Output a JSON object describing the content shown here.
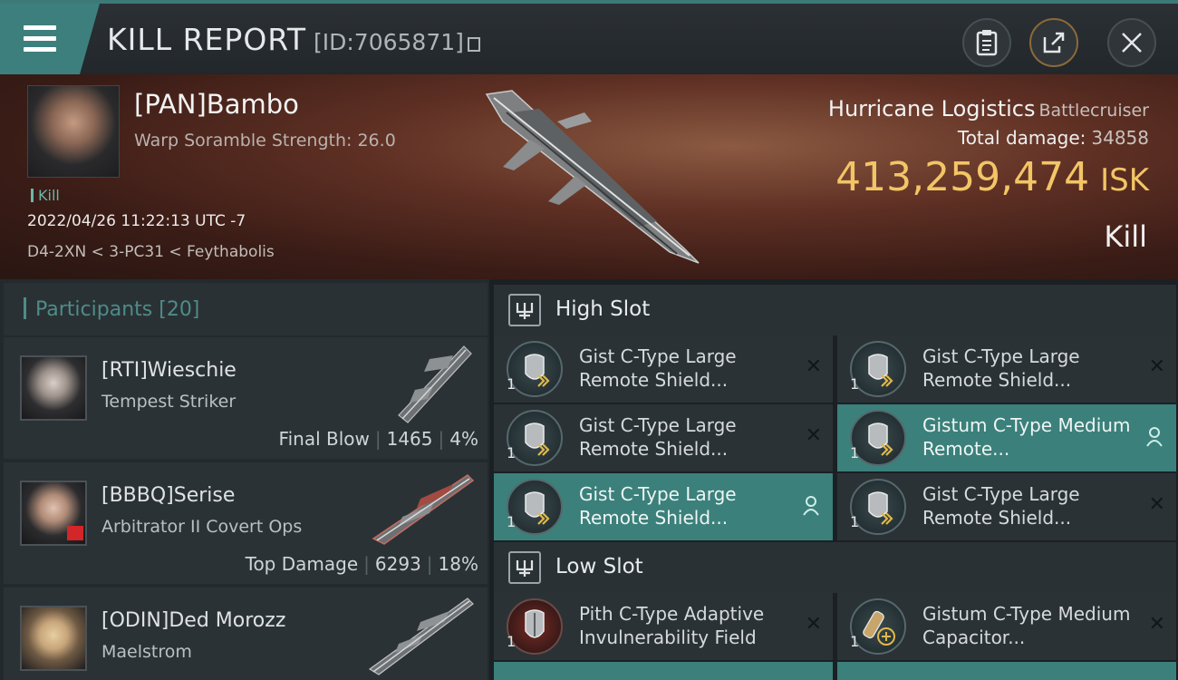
{
  "header": {
    "title": "KILL REPORT",
    "report_id": "[ID:7065871]",
    "menu_icon": "hamburger-icon",
    "buttons": [
      {
        "name": "clipboard-icon"
      },
      {
        "name": "share-icon"
      },
      {
        "name": "close-icon"
      }
    ]
  },
  "victim": {
    "pilot": "[PAN]Bambo",
    "warp_scramble": "Warp Soramble Strength: 26.0",
    "kill_tag": "Kill",
    "time": "2022/04/26 11:22:13 UTC -7",
    "location": "D4-2XN < 3-PC31 < Feythabolis",
    "ship": "Hurricane Logistics",
    "ship_class": "Battlecruiser",
    "total_damage_label": "Total damage:",
    "total_damage": "34858",
    "isk_value": "413,259,474",
    "isk_unit": "ISK",
    "result": "Kill"
  },
  "participants": {
    "title": "Participants",
    "count": "[20]",
    "rows": [
      {
        "name": "[RTI]Wieschie",
        "ship": "Tempest Striker",
        "tag": "Final Blow",
        "damage": "1465",
        "percent": "4%"
      },
      {
        "name": "[BBBQ]Serise",
        "ship": "Arbitrator II Covert Ops",
        "tag": "Top Damage",
        "damage": "6293",
        "percent": "18%"
      },
      {
        "name": "[ODIN]Ded Morozz",
        "ship": "Maelstrom",
        "tag": "",
        "damage": "",
        "percent": ""
      }
    ]
  },
  "high_slot": {
    "title": "High Slot",
    "modules": [
      {
        "name": "Gist C-Type Large Remote Shield...",
        "qty": "1",
        "status": "destroyed"
      },
      {
        "name": "Gist C-Type Large Remote Shield...",
        "qty": "1",
        "status": "destroyed"
      },
      {
        "name": "Gist C-Type Large Remote Shield...",
        "qty": "1",
        "status": "destroyed"
      },
      {
        "name": "Gistum C-Type Medium Remote...",
        "qty": "1",
        "status": "dropped"
      },
      {
        "name": "Gist C-Type Large Remote Shield...",
        "qty": "1",
        "status": "dropped"
      },
      {
        "name": "Gist C-Type Large Remote Shield...",
        "qty": "1",
        "status": "destroyed"
      }
    ]
  },
  "low_slot": {
    "title": "Low Slot",
    "modules": [
      {
        "name": "Pith C-Type Adaptive Invulnerability Field",
        "qty": "1",
        "status": "destroyed"
      },
      {
        "name": "Gistum C-Type Medium Capacitor...",
        "qty": "1",
        "status": "destroyed"
      }
    ]
  },
  "colors": {
    "accent": "#3d7f7c",
    "isk": "#f2c566",
    "panel": "#2b3236"
  }
}
